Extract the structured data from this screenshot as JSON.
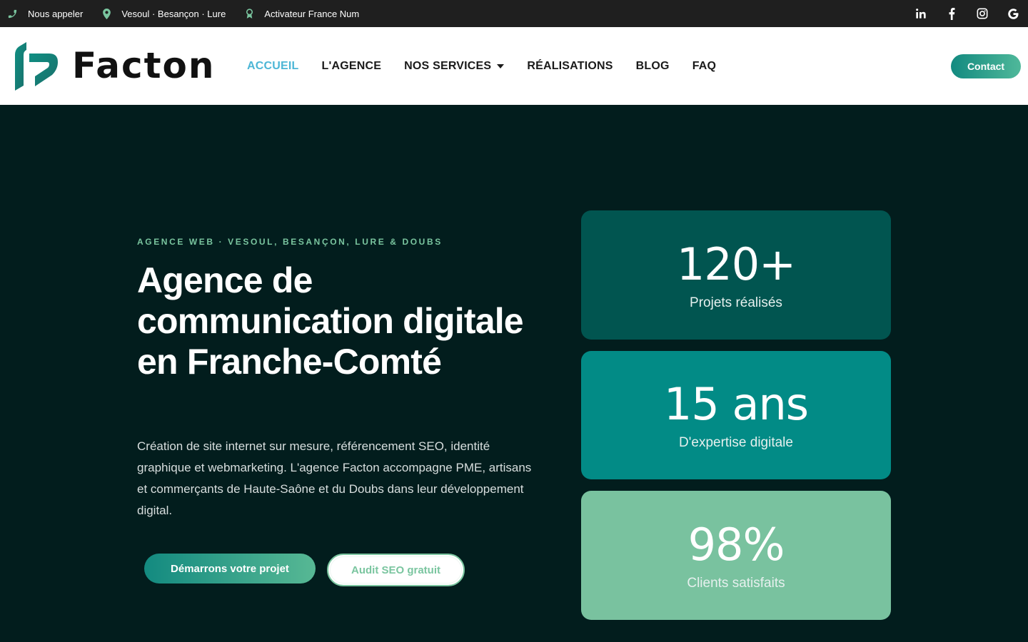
{
  "topbar": {
    "phone_label": "Nous appeler",
    "location_label": "Vesoul · Besançon · Lure",
    "badge_label": "Activateur France Num",
    "accent_color": "#7ac59f"
  },
  "header": {
    "logo_text": "Facton",
    "nav": [
      {
        "label": "ACCUEIL"
      },
      {
        "label": "L'AGENCE"
      },
      {
        "label": "NOS SERVICES"
      },
      {
        "label": "RÉALISATIONS"
      },
      {
        "label": "BLOG"
      },
      {
        "label": "FAQ"
      }
    ],
    "contact_label": "Contact"
  },
  "hero": {
    "kicker": "AGENCE WEB · VESOUL, BESANÇON, LURE & DOUBS",
    "title": "Agence de communication digitale en Franche-Comté",
    "description": "Création de site internet sur mesure, référencement SEO, identité graphique et webmarketing. L'agence Facton accompagne PME, artisans et commerçants de Haute-Saône et du Doubs dans leur développement digital.",
    "primary_cta": "Démarrons votre projet",
    "secondary_cta": "Audit SEO gratuit"
  },
  "stats": [
    {
      "value": "120+",
      "label": "Projets réalisés",
      "color": "#015550"
    },
    {
      "value": "15 ans",
      "label": "D'expertise digitale",
      "color": "#028b86"
    },
    {
      "value": "98%",
      "label": "Clients satisfaits",
      "color": "#79c29f"
    }
  ]
}
